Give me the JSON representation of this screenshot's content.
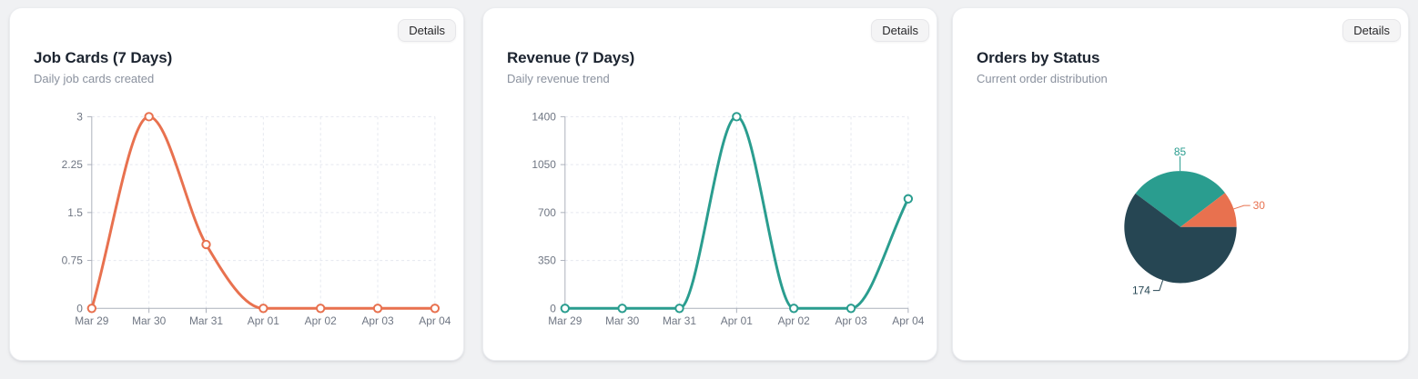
{
  "cards": [
    {
      "title": "Job Cards (7 Days)",
      "subtitle": "Daily job cards created",
      "details_label": "Details"
    },
    {
      "title": "Revenue (7 Days)",
      "subtitle": "Daily revenue trend",
      "details_label": "Details"
    },
    {
      "title": "Orders by Status",
      "subtitle": "Current order distribution",
      "details_label": "Details"
    }
  ],
  "chart_data": [
    {
      "type": "line",
      "title": "Job Cards (7 Days)",
      "categories": [
        "Mar 29",
        "Mar 30",
        "Mar 31",
        "Apr 01",
        "Apr 02",
        "Apr 03",
        "Apr 04"
      ],
      "series": [
        {
          "name": "Job Cards",
          "values": [
            0,
            3,
            1,
            0,
            0,
            0,
            0
          ],
          "color": "#e8714f"
        }
      ],
      "yticks": [
        0,
        0.75,
        1.5,
        2.25,
        3
      ],
      "ylim": [
        0,
        3
      ],
      "xlabel": "",
      "ylabel": "",
      "grid": true,
      "smooth": true,
      "legend": false
    },
    {
      "type": "line",
      "title": "Revenue (7 Days)",
      "categories": [
        "Mar 29",
        "Mar 30",
        "Mar 31",
        "Apr 01",
        "Apr 02",
        "Apr 03",
        "Apr 04"
      ],
      "series": [
        {
          "name": "Revenue",
          "values": [
            0,
            0,
            0,
            1400,
            0,
            0,
            800
          ],
          "color": "#2a9d8f"
        }
      ],
      "yticks": [
        0,
        350,
        700,
        1050,
        1400
      ],
      "ylim": [
        0,
        1400
      ],
      "xlabel": "",
      "ylabel": "",
      "grid": true,
      "smooth": true,
      "legend": false
    },
    {
      "type": "pie",
      "title": "Orders by Status",
      "slices": [
        {
          "value": 85,
          "color": "#2a9d8f"
        },
        {
          "value": 30,
          "color": "#e8714f"
        },
        {
          "value": 174,
          "color": "#264653"
        }
      ],
      "start_angle_deg": 143.3,
      "clockwise": true,
      "labels": "value",
      "legend": false
    }
  ]
}
